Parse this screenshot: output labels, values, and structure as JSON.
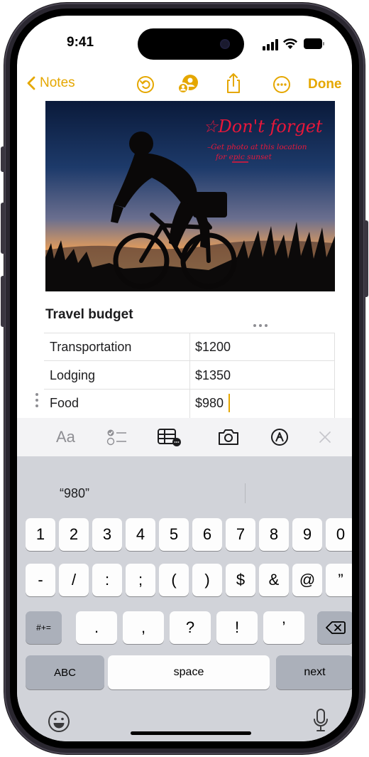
{
  "status_bar": {
    "time": "9:41"
  },
  "nav": {
    "back_label": "Notes",
    "done_label": "Done",
    "icons": [
      "undo-icon",
      "collaborate-icon",
      "share-icon",
      "more-icon"
    ]
  },
  "photo": {
    "annotation_title": "☆Don't forget",
    "annotation_line1": "–Get photo at this location",
    "annotation_line2": "for epic sunset"
  },
  "note": {
    "title": "Travel budget",
    "table": [
      {
        "label": "Transportation",
        "value": "$1200"
      },
      {
        "label": "Lodging",
        "value": "$1350"
      },
      {
        "label": "Food",
        "value": "$980"
      }
    ]
  },
  "format_bar": {
    "text_format_label": "Aa",
    "icons": [
      "checklist-icon",
      "table-icon",
      "camera-icon",
      "markup-icon",
      "close-icon"
    ]
  },
  "keyboard": {
    "suggestion": "“980”",
    "row1": [
      "1",
      "2",
      "3",
      "4",
      "5",
      "6",
      "7",
      "8",
      "9",
      "0"
    ],
    "row2": [
      "-",
      "/",
      ":",
      ";",
      "(",
      ")",
      "$",
      "&",
      "@",
      "”"
    ],
    "row3": [
      ".",
      ",",
      "?",
      "!",
      "’"
    ],
    "symbols_label": "#+=",
    "abc_label": "ABC",
    "space_label": "space",
    "next_label": "next"
  },
  "colors": {
    "accent": "#e5a700",
    "annotation": "#e8173a"
  }
}
